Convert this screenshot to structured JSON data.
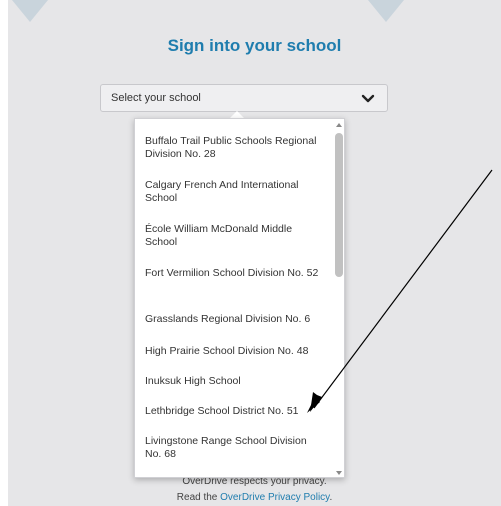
{
  "header": {
    "title": "Sign into your school"
  },
  "school_select": {
    "value": "Select your school"
  },
  "dropdown": {
    "options": [
      "Buffalo Trail Public Schools Regional Division No. 28",
      "Calgary French And International School",
      "École William McDonald Middle School",
      "Fort Vermilion School Division No. 52",
      "Grasslands Regional Division No. 6",
      "High Prairie School Division No. 48",
      "Inuksuk High School",
      "Lethbridge School District No. 51",
      "Livingstone Range School Division No. 68"
    ]
  },
  "privacy": {
    "line1": "OverDrive respects your privacy.",
    "line2_prefix": "Read the ",
    "line2_link": "OverDrive Privacy Policy",
    "line2_suffix": "."
  },
  "colors": {
    "accent": "#1f7dae",
    "background": "#e6e6e8",
    "annotation_arrow": "#000000"
  },
  "icons": {
    "select_chevron": "chevron-down-icon",
    "scroll_up": "scroll-up-arrow-icon",
    "scroll_down": "scroll-down-arrow-icon",
    "annotation": "annotation-arrow-icon"
  }
}
